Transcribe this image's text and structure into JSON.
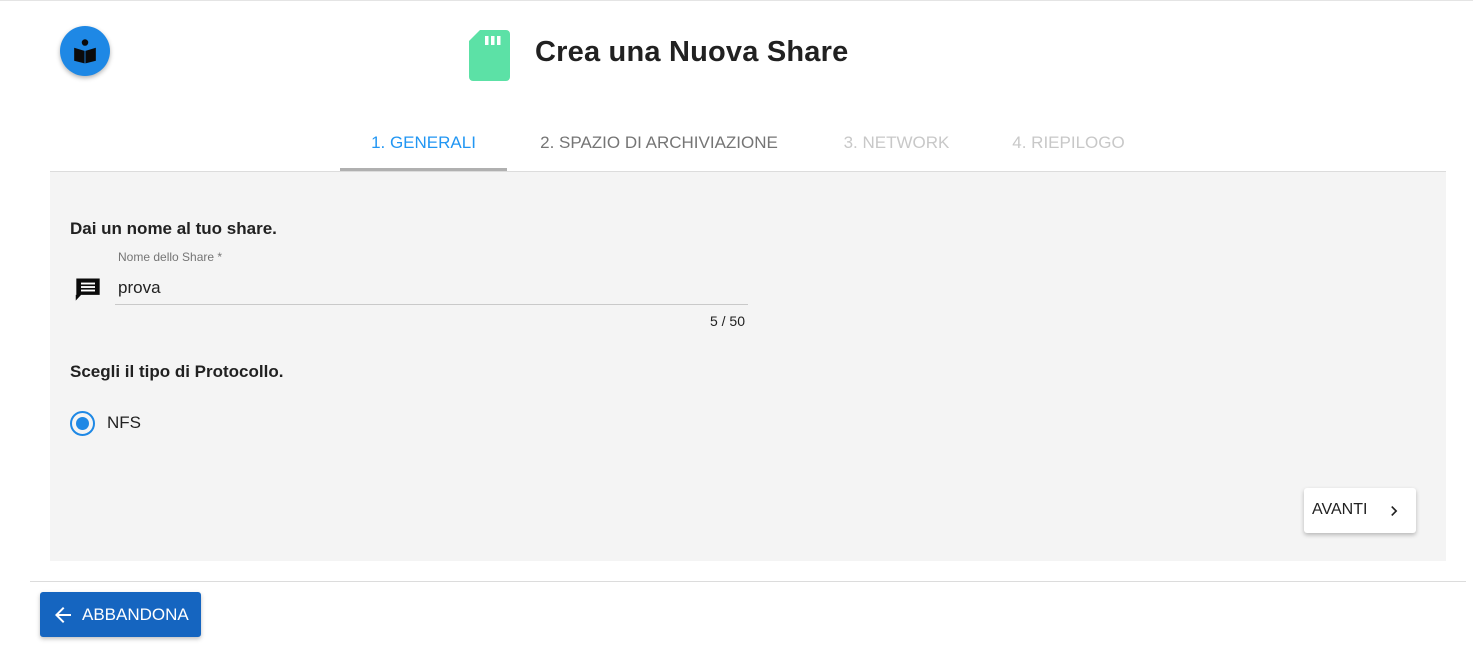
{
  "header": {
    "title": "Crea una Nuova Share",
    "help_icon": "book-reader-icon",
    "title_icon": "sd-card-icon",
    "title_icon_color": "#5ce1a6"
  },
  "tabs": [
    {
      "label": "1. GENERALI",
      "state": "active"
    },
    {
      "label": "2. SPAZIO DI ARCHIVIAZIONE",
      "state": "enabled"
    },
    {
      "label": "3. NETWORK",
      "state": "disabled"
    },
    {
      "label": "4. RIEPILOGO",
      "state": "disabled"
    }
  ],
  "form": {
    "name_heading": "Dai un nome al tuo share.",
    "name_field": {
      "label": "Nome dello Share *",
      "value": "prova",
      "counter": "5 / 50",
      "icon": "message-icon"
    },
    "protocol_heading": "Scegli il tipo di Protocollo.",
    "protocol_options": [
      {
        "label": "NFS",
        "selected": true
      }
    ]
  },
  "actions": {
    "next_label": "AVANTI",
    "abandon_label": "ABBANDONA"
  },
  "colors": {
    "primary": "#2196f3",
    "abandon_button": "#1565c0",
    "panel_background": "#f4f4f4"
  }
}
